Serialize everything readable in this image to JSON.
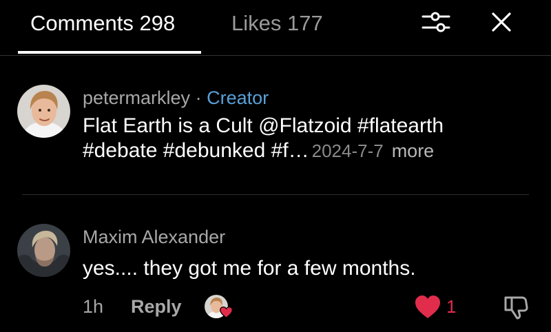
{
  "header": {
    "tabs": [
      {
        "label": "Comments 298",
        "active": true
      },
      {
        "label": "Likes 177",
        "active": false
      }
    ],
    "filter_icon": "sliders-icon",
    "close_icon": "close-icon"
  },
  "comments": [
    {
      "author": "petermarkley",
      "separator": "·",
      "badge": "Creator",
      "text_line1": "Flat Earth is a Cult @Flatzoid #flatearth",
      "text_line2": "#debate #debunked #f…",
      "date": "2024-7-7",
      "more": "more"
    },
    {
      "author": "Maxim Alexander",
      "text": "yes.... they got me for a few months.",
      "time": "1h",
      "reply": "Reply",
      "like_count": "1"
    }
  ],
  "colors": {
    "background": "#000000",
    "creator_badge": "#5aa0d8",
    "like_red": "#e12d4b",
    "muted_text": "#a8a8a8"
  }
}
